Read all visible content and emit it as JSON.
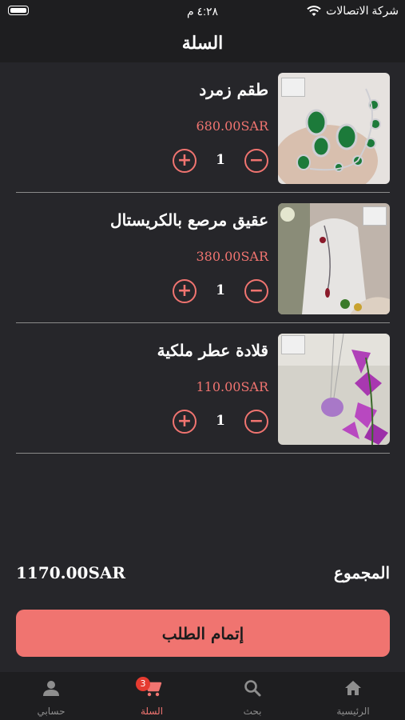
{
  "status_bar": {
    "carrier": "شركة الاتصالات",
    "time": "٤:٢٨ م"
  },
  "header": {
    "title": "السلة"
  },
  "colors": {
    "accent": "#f07470",
    "background": "#26262a",
    "bar": "#1e1e20",
    "badge": "#e53b30"
  },
  "cart": {
    "items": [
      {
        "name": "طقم زمرد",
        "price": "680.00SAR",
        "quantity": "1",
        "image": "emerald-jewelry-set",
        "plus": "+",
        "minus": "−"
      },
      {
        "name": "عقيق مرصع بالكريستال",
        "price": "380.00SAR",
        "quantity": "1",
        "image": "crystal-agate-necklace",
        "plus": "+",
        "minus": "−"
      },
      {
        "name": "قلادة عطر ملكية",
        "price": "110.00SAR",
        "quantity": "1",
        "image": "perfume-pendant",
        "plus": "+",
        "minus": "−"
      }
    ]
  },
  "summary": {
    "total_label": "المجموع",
    "total_value": "1170.00SAR"
  },
  "checkout": {
    "label": "إتمام الطلب"
  },
  "tabs": [
    {
      "label": "الرئيسية",
      "icon": "home-icon"
    },
    {
      "label": "بحث",
      "icon": "search-icon"
    },
    {
      "label": "السلة",
      "icon": "cart-icon",
      "badge": "3",
      "active": true
    },
    {
      "label": "حسابي",
      "icon": "person-icon"
    }
  ]
}
